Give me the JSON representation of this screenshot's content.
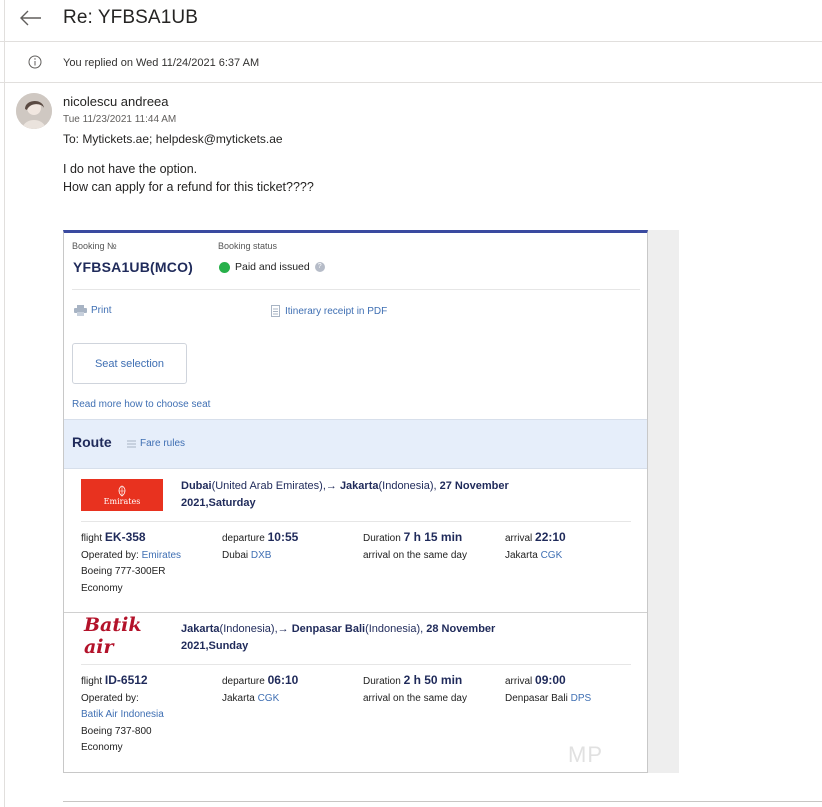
{
  "header": {
    "subject": "Re: YFBSA1UB"
  },
  "replied": {
    "text": "You replied on Wed 11/24/2021 6:37 AM"
  },
  "message": {
    "sender": "nicolescu andreea",
    "date": "Tue 11/23/2021 11:44 AM",
    "to": "To:  Mytickets.ae; helpdesk@mytickets.ae",
    "body_line1": "I do not have the option.",
    "body_line2": "How can apply for a refund for this ticket????"
  },
  "booking": {
    "no_label": "Booking №",
    "no_value": "YFBSA1UB(MCO)",
    "status_label": "Booking status",
    "status_value": "Paid and issued",
    "print": "Print",
    "receipt": "Itinerary receipt in PDF",
    "seat_button": "Seat selection",
    "read_more": "Read more how to choose seat",
    "route_title": "Route",
    "fare_rules": "Fare rules"
  },
  "segments": [
    {
      "logo": "Emirates",
      "from": "Dubai",
      "from_country": "(United Arab Emirates),→ ",
      "to": "Jakarta",
      "to_country": "(Indonesia), ",
      "date": "27 November",
      "day": "2021,Saturday",
      "flight_label": "flight ",
      "flight": "EK-358",
      "operated_label": "Operated by: ",
      "operated": "Emirates",
      "aircraft": "Boeing 777-300ER",
      "cabin": "Economy",
      "dep_label": "departure ",
      "dep_time": "10:55",
      "dep_city": "Dubai ",
      "dep_code": "DXB",
      "dur_label": "Duration ",
      "duration": "7 h 15 min",
      "arr_note": "arrival on the same day",
      "arr_label": "arrival ",
      "arr_time": "22:10",
      "arr_city": "Jakarta ",
      "arr_code": "CGK"
    },
    {
      "logo": "Batik air",
      "from": "Jakarta",
      "from_country": "(Indonesia),→ ",
      "to": "Denpasar Bali",
      "to_country": "(Indonesia), ",
      "date": "28 November",
      "day": "2021,Sunday",
      "flight_label": "flight ",
      "flight": "ID-6512",
      "operated_label": "Operated by:",
      "operated": "Batik Air Indonesia",
      "aircraft": "Boeing 737-800",
      "cabin": "Economy",
      "dep_label": "departure ",
      "dep_time": "06:10",
      "dep_city": "Jakarta ",
      "dep_code": "CGK",
      "dur_label": "Duration ",
      "duration": "2 h 50 min",
      "arr_note": "arrival on the same day",
      "arr_label": "arrival ",
      "arr_time": "09:00",
      "arr_city": "Denpasar Bali ",
      "arr_code": "DPS"
    }
  ],
  "watermark": "MP"
}
